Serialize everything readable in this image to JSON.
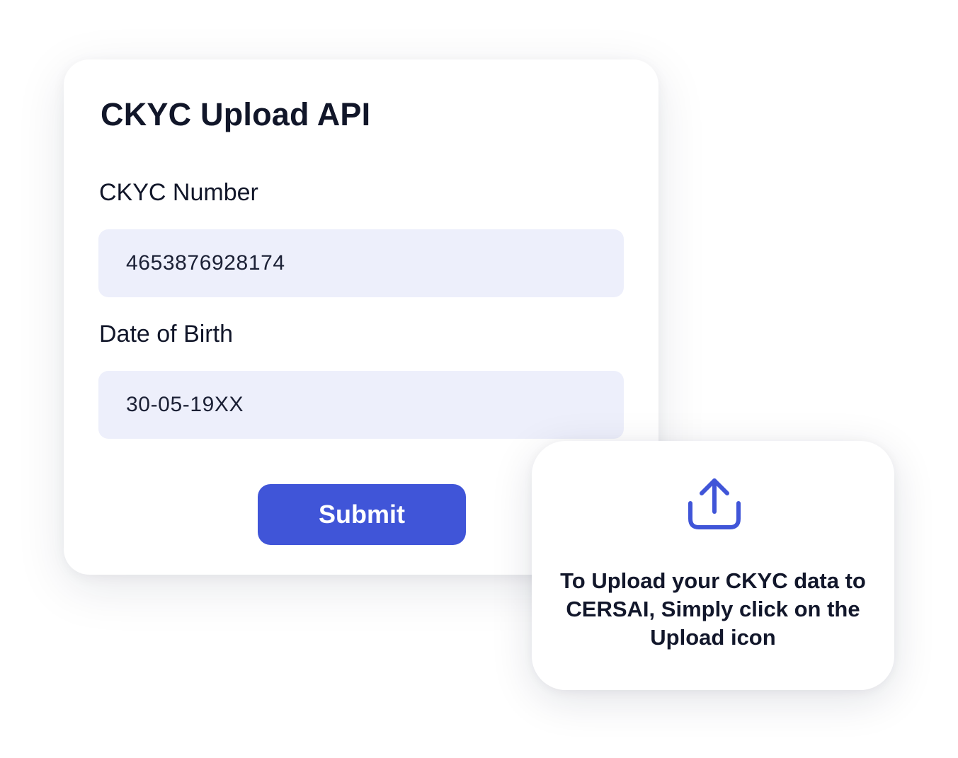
{
  "form": {
    "title": "CKYC Upload API",
    "ckyc_label": "CKYC Number",
    "ckyc_value": "4653876928174",
    "dob_label": "Date of Birth",
    "dob_value": "30-05-19XX",
    "submit_label": "Submit"
  },
  "upload_card": {
    "icon": "upload-icon",
    "text": "To Upload your CKYC data to CERSAI, Simply click on the Upload icon"
  },
  "colors": {
    "accent": "#4055d8",
    "field_background": "#edeffb",
    "text": "#111629",
    "background": "#ffffff"
  }
}
